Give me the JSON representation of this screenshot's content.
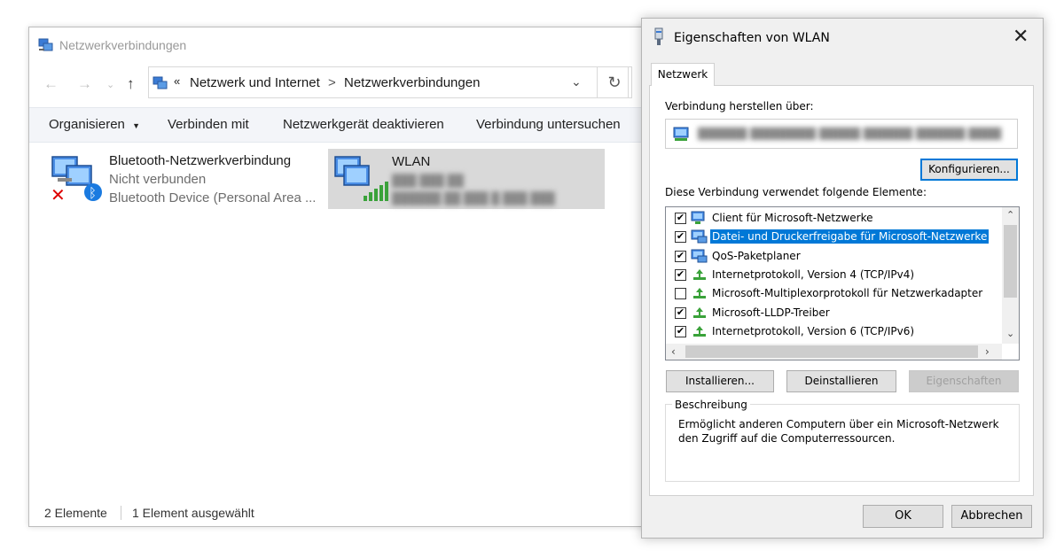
{
  "explorer": {
    "title": "Netzwerkverbindungen",
    "breadcrumb": {
      "sep_prefix": "«",
      "part1": "Netzwerk und Internet",
      "sep": ">",
      "part2": "Netzwerkverbindungen"
    },
    "toolbar": {
      "organize": "Organisieren",
      "connect": "Verbinden mit",
      "disable": "Netzwerkgerät deaktivieren",
      "diagnose": "Verbindung untersuchen"
    },
    "items": [
      {
        "title": "Bluetooth-Netzwerkverbindung",
        "line2": "Nicht verbunden",
        "line3": "Bluetooth Device (Personal Area ..."
      },
      {
        "title": "WLAN",
        "line2": "███ ███ ██",
        "line3": "██████ ██ ███ █ ███ ███"
      }
    ],
    "status": {
      "count": "2 Elemente",
      "selected": "1 Element ausgewählt"
    }
  },
  "dialog": {
    "title": "Eigenschaften von WLAN",
    "tab": "Netzwerk",
    "connect_via": "Verbindung herstellen über:",
    "adapter_name": "██████ ████████ █████ ██████ ██████ ████",
    "configure": "Konfigurieren...",
    "elements_label": "Diese Verbindung verwendet folgende Elemente:",
    "elements": [
      {
        "label": "Client für Microsoft-Netzwerke",
        "checked": true,
        "icon": "network-client-icon"
      },
      {
        "label": "Datei- und Druckerfreigabe für Microsoft-Netzwerke",
        "checked": true,
        "icon": "network-service-icon",
        "selected": true
      },
      {
        "label": "QoS-Paketplaner",
        "checked": true,
        "icon": "network-service-icon"
      },
      {
        "label": "Internetprotokoll, Version 4 (TCP/IPv4)",
        "checked": true,
        "icon": "protocol-icon"
      },
      {
        "label": "Microsoft-Multiplexorprotokoll für Netzwerkadapter",
        "checked": false,
        "icon": "protocol-icon"
      },
      {
        "label": "Microsoft-LLDP-Treiber",
        "checked": true,
        "icon": "protocol-icon"
      },
      {
        "label": "Internetprotokoll, Version 6 (TCP/IPv6)",
        "checked": true,
        "icon": "protocol-icon"
      }
    ],
    "install": "Installieren...",
    "uninstall": "Deinstallieren",
    "properties": "Eigenschaften",
    "description_label": "Beschreibung",
    "description_text": "Ermöglicht anderen Computern über ein Microsoft-Netzwerk den Zugriff auf die Computerressourcen.",
    "ok": "OK",
    "cancel": "Abbrechen"
  },
  "colors": {
    "selection": "#0078d7",
    "toolbar_bg": "#f3f5f9",
    "selected_item_bg": "#d9d9d9"
  }
}
